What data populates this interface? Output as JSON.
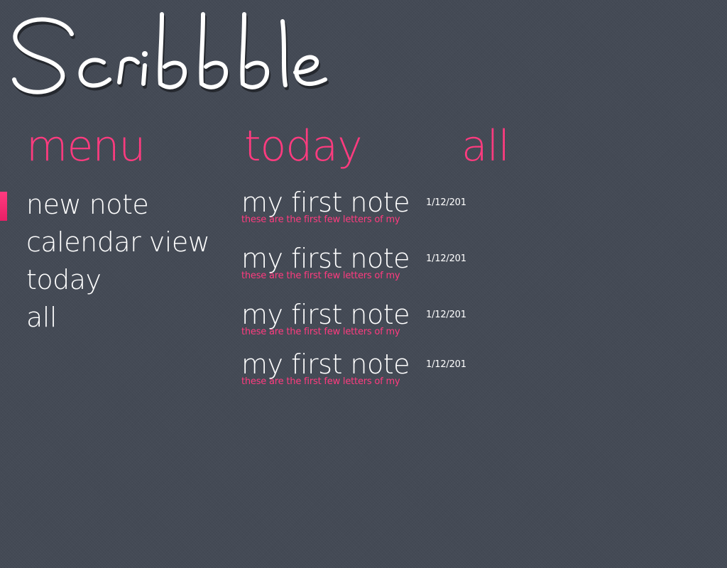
{
  "app": {
    "logo_text": "Scribbble"
  },
  "columns": {
    "menu": "menu",
    "today": "today",
    "all": "all"
  },
  "menu": {
    "items": [
      {
        "label": "new note",
        "selected": true
      },
      {
        "label": "calendar view",
        "selected": false
      },
      {
        "label": "today",
        "selected": false
      },
      {
        "label": "all",
        "selected": false
      }
    ]
  },
  "notes": [
    {
      "title": "my first note",
      "preview": "these are the first few letters of my",
      "date": "1/12/201"
    },
    {
      "title": "my first note",
      "preview": "these are the first few letters of my",
      "date": "1/12/201"
    },
    {
      "title": "my first note",
      "preview": "these are the first few letters of my",
      "date": "1/12/201"
    },
    {
      "title": "my first note",
      "preview": "these are the first few letters of my",
      "date": "1/12/201"
    }
  ],
  "colors": {
    "accent": "#ff3b7f",
    "background": "#444a55",
    "text": "#ffffff"
  }
}
